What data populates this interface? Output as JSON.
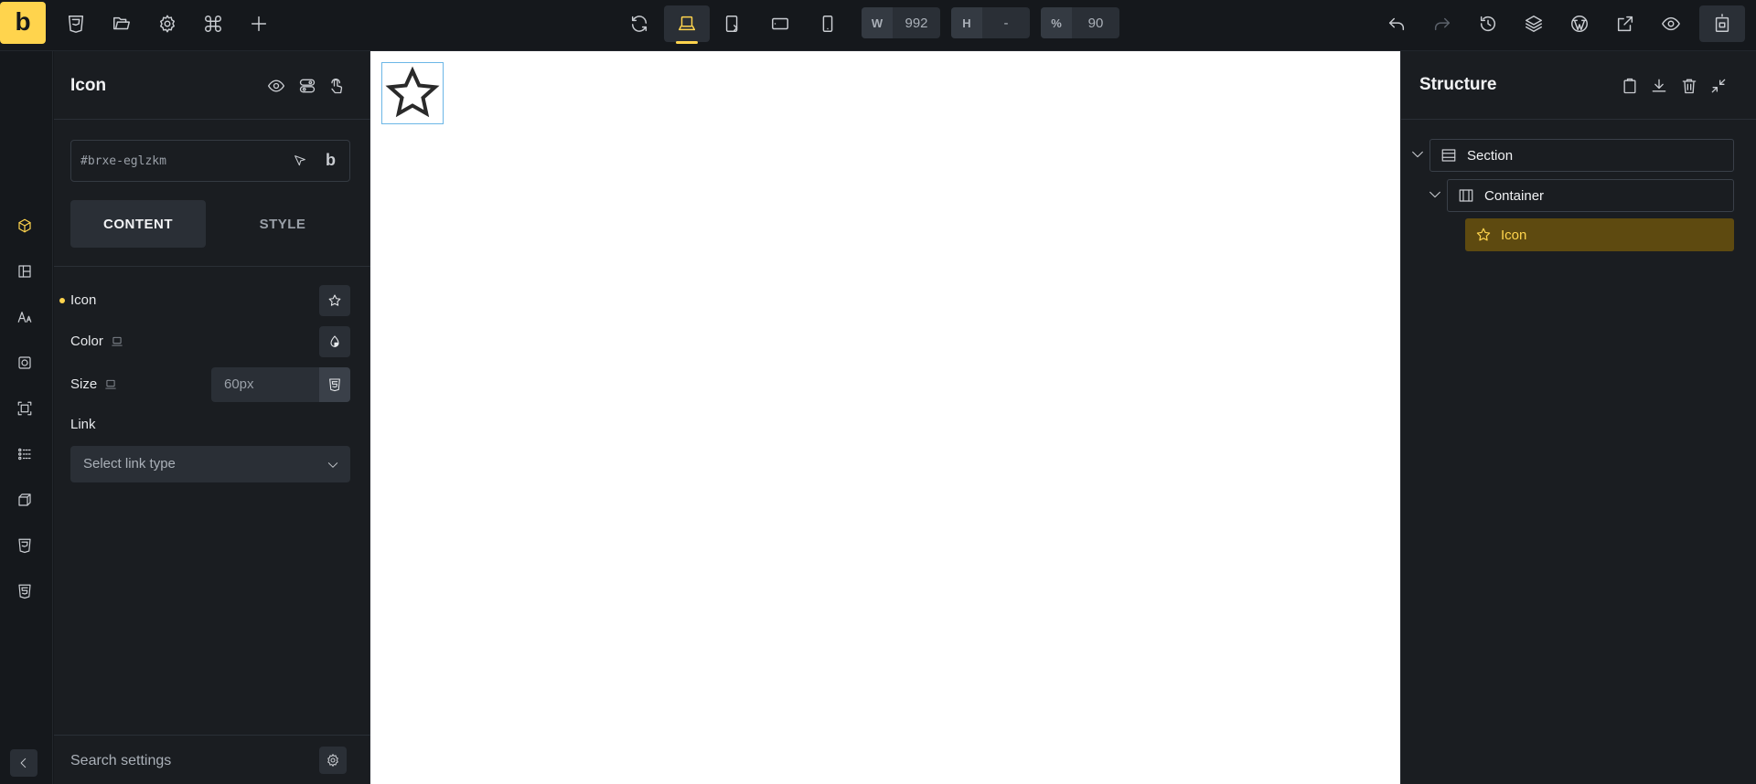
{
  "toolbar": {
    "logo": "b",
    "width_label": "W",
    "width_value": "992",
    "height_label": "H",
    "height_value": "-",
    "zoom_label": "%",
    "zoom_value": "90"
  },
  "settings": {
    "title": "Icon",
    "element_id": "#brxe-eglzkm",
    "id_brand": "b",
    "tabs": [
      "CONTENT",
      "STYLE"
    ],
    "controls": {
      "icon_label": "Icon",
      "color_label": "Color",
      "size_label": "Size",
      "size_value": "60px",
      "link_label": "Link",
      "link_placeholder": "Select link type"
    },
    "search_label": "Search settings"
  },
  "structure": {
    "title": "Structure",
    "nodes": [
      {
        "label": "Section",
        "icon": "section-icon"
      },
      {
        "label": "Container",
        "icon": "container-icon"
      },
      {
        "label": "Icon",
        "icon": "star-icon"
      }
    ]
  },
  "colors": {
    "accent": "#ffd44d",
    "background": "#15181c",
    "panel": "#1a1d21",
    "selected_node": "#5e4a10"
  }
}
